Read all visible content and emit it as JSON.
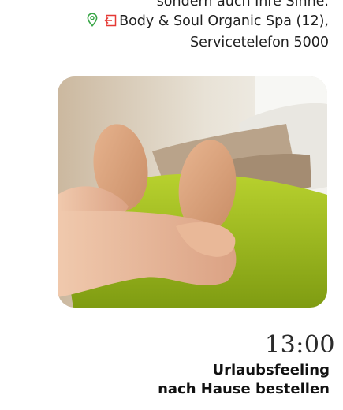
{
  "intro": {
    "partial_line": "sondern auch Ihre Sinne.",
    "location": "Body & Soul Organic Spa (12),",
    "phone": "Servicetelefon 5000"
  },
  "icons": {
    "pin": "location-pin-icon",
    "enter": "entrance-icon",
    "pin_color": "#3aa648",
    "enter_color": "#e53935"
  },
  "event": {
    "time": "13:00",
    "title_line1": "Urlaubsfeeling",
    "title_line2": "nach Hause bestellen"
  }
}
